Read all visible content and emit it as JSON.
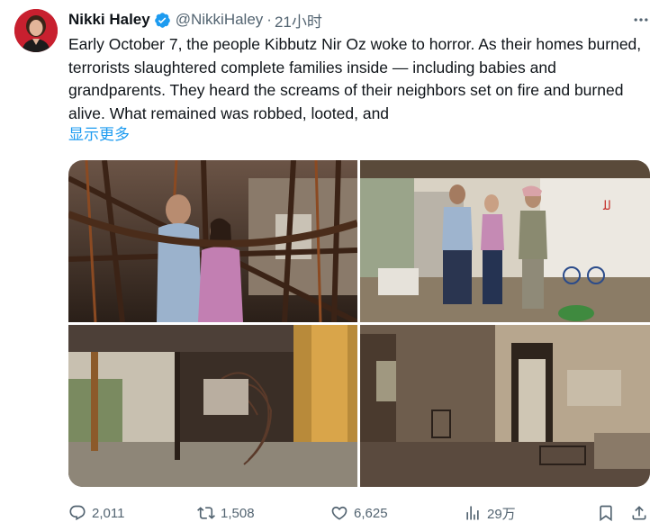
{
  "author": {
    "display_name": "Nikki Haley",
    "handle": "@NikkiHaley",
    "separator": "·",
    "time": "21小时",
    "verified": true,
    "verified_color": "#1d9bf0"
  },
  "tweet": {
    "text": "Early October 7, the people Kibbutz Nir Oz woke to horror. As their homes burned, terrorists slaughtered complete families inside — including babies and grandparents. They heard the screams of their neighbors set on fire and burned alive. What remained was robbed, looted, and",
    "show_more": "显示更多"
  },
  "media": {
    "photos": [
      {
        "subject": "two people standing among charred house frame"
      },
      {
        "subject": "three people talking outside damaged house"
      },
      {
        "subject": "burned-out house interior with twisted metal"
      },
      {
        "subject": "gutted room with blackened walls and doorway"
      }
    ]
  },
  "actions": {
    "reply_count": "2,011",
    "retweet_count": "1,508",
    "like_count": "6,625",
    "views_count": "29万"
  },
  "colors": {
    "text": "#0f1419",
    "secondary": "#536471",
    "accent": "#1d9bf0"
  },
  "icons": [
    "more-icon",
    "verified-icon",
    "reply-icon",
    "retweet-icon",
    "like-icon",
    "views-icon",
    "bookmark-icon",
    "share-icon"
  ]
}
